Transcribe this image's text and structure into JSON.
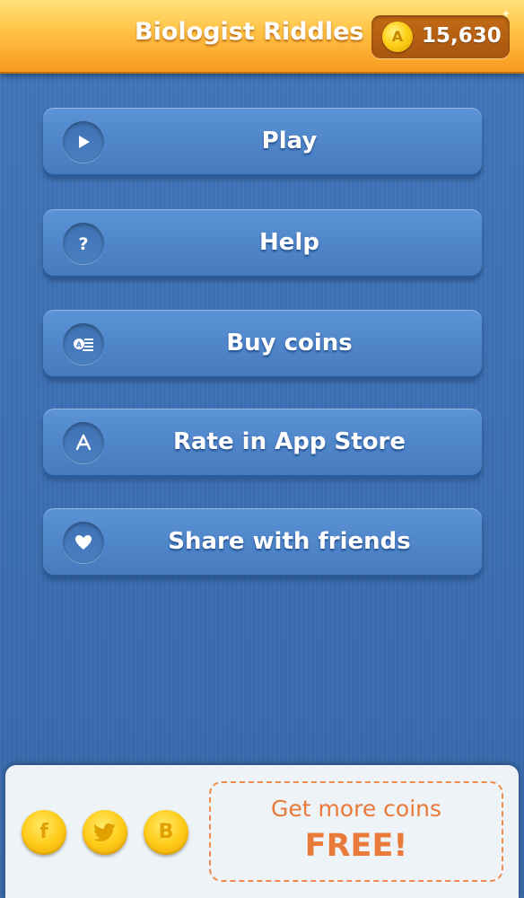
{
  "header": {
    "title": "Biologist Riddles",
    "coin_symbol": "A",
    "coin_count": "15,630"
  },
  "menu": {
    "items": [
      {
        "label": "Play",
        "icon": "play-icon"
      },
      {
        "label": "Help",
        "icon": "help-icon"
      },
      {
        "label": "Buy coins",
        "icon": "coins-icon"
      },
      {
        "label": "Rate in App Store",
        "icon": "app-store-icon"
      },
      {
        "label": "Share with friends",
        "icon": "heart-icon"
      }
    ]
  },
  "bottom": {
    "social": [
      {
        "glyph": "f",
        "icon": "facebook-icon"
      },
      {
        "glyph": "🐦",
        "icon": "twitter-icon"
      },
      {
        "glyph": "B",
        "icon": "b-icon"
      }
    ],
    "offer_line1": "Get more coins",
    "offer_line2": "FREE!"
  },
  "colors": {
    "header_orange": "#f7a324",
    "button_blue": "#5088cc",
    "offer_orange": "#ea7a3a",
    "coin_gold": "#ffcc1a"
  }
}
